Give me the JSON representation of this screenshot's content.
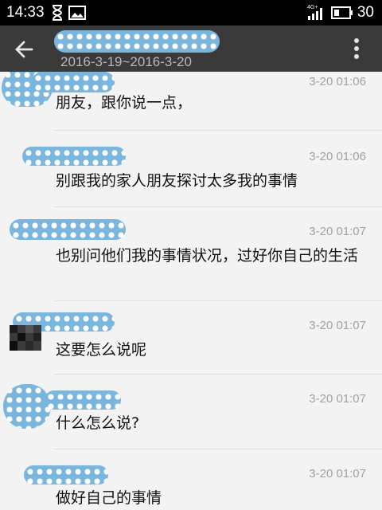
{
  "status_bar": {
    "time": "14:33",
    "network_label": "4G+",
    "battery_value": "30"
  },
  "app_bar": {
    "back_icon": "arrow-left-icon",
    "date_range": "2016-3-19~2016-3-20",
    "menu_icon": "overflow-menu-icon"
  },
  "messages": [
    {
      "time": "3-20 01:06",
      "text": "朋友，跟你说一点，"
    },
    {
      "time": "3-20 01:06",
      "text": "别跟我的家人朋友探讨太多我的事情"
    },
    {
      "time": "3-20 01:07",
      "text": "也别问他们我的事情状况，过好你自己的生活"
    },
    {
      "time": "3-20 01:07",
      "text": "这要怎么说呢"
    },
    {
      "time": "3-20 01:07",
      "text": "什么怎么说?"
    },
    {
      "time": "3-20 01:07",
      "text": "做好自己的事情"
    }
  ]
}
